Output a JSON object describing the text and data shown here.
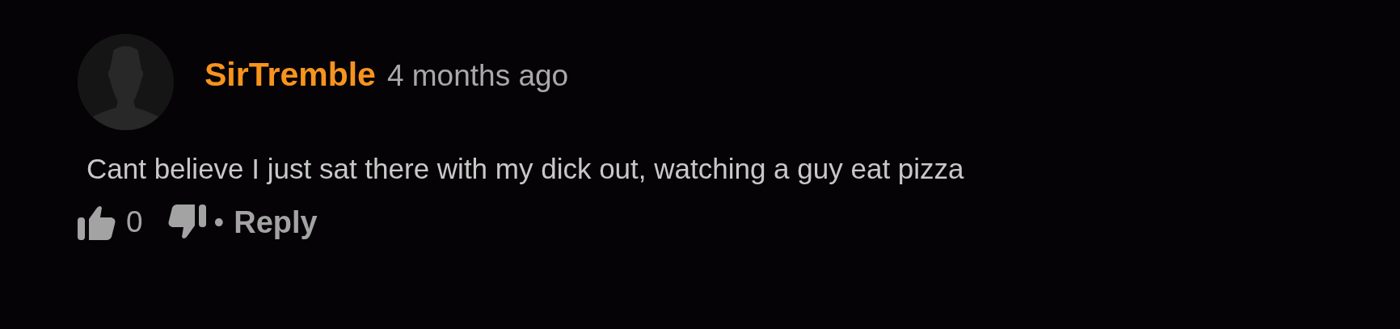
{
  "comment": {
    "author": "SirTremble",
    "time": "4 months ago",
    "text": "Cant believe I just sat there with my dick out, watching a guy eat pizza",
    "likes": "0",
    "separator": "•",
    "reply": "Reply"
  }
}
